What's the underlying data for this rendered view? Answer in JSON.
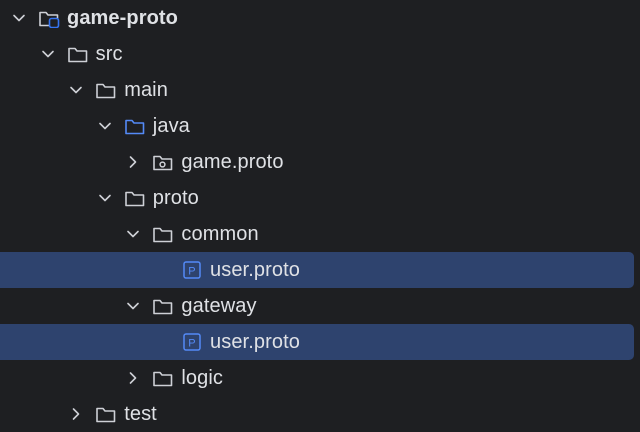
{
  "tree": [
    {
      "label": "game-proto",
      "depth": 0,
      "expanded": true,
      "icon": "module-folder-icon",
      "bold": true,
      "selected": false
    },
    {
      "label": "src",
      "depth": 1,
      "expanded": true,
      "icon": "folder-icon",
      "bold": false,
      "selected": false
    },
    {
      "label": "main",
      "depth": 2,
      "expanded": true,
      "icon": "folder-icon",
      "bold": false,
      "selected": false
    },
    {
      "label": "java",
      "depth": 3,
      "expanded": true,
      "icon": "source-folder-icon",
      "bold": false,
      "selected": false
    },
    {
      "label": "game.proto",
      "depth": 4,
      "expanded": false,
      "icon": "package-icon",
      "bold": false,
      "selected": false
    },
    {
      "label": "proto",
      "depth": 3,
      "expanded": true,
      "icon": "folder-icon",
      "bold": false,
      "selected": false
    },
    {
      "label": "common",
      "depth": 4,
      "expanded": true,
      "icon": "folder-icon",
      "bold": false,
      "selected": false
    },
    {
      "label": "user.proto",
      "depth": 5,
      "expanded": null,
      "icon": "proto-file-icon",
      "bold": false,
      "selected": true
    },
    {
      "label": "gateway",
      "depth": 4,
      "expanded": true,
      "icon": "folder-icon",
      "bold": false,
      "selected": false
    },
    {
      "label": "user.proto",
      "depth": 5,
      "expanded": null,
      "icon": "proto-file-icon",
      "bold": false,
      "selected": true
    },
    {
      "label": "logic",
      "depth": 4,
      "expanded": false,
      "icon": "folder-icon",
      "bold": false,
      "selected": false
    },
    {
      "label": "test",
      "depth": 2,
      "expanded": false,
      "icon": "folder-icon",
      "bold": false,
      "selected": false
    }
  ],
  "colors": {
    "background": "#1e1f22",
    "selection": "#2e436e",
    "text": "#dfe1e5",
    "icon_stroke": "#ced0d6",
    "source_folder": "#548af7",
    "module_badge": "#3574f0",
    "proto_badge": "#548af7"
  },
  "proto_badge_letter": "P"
}
